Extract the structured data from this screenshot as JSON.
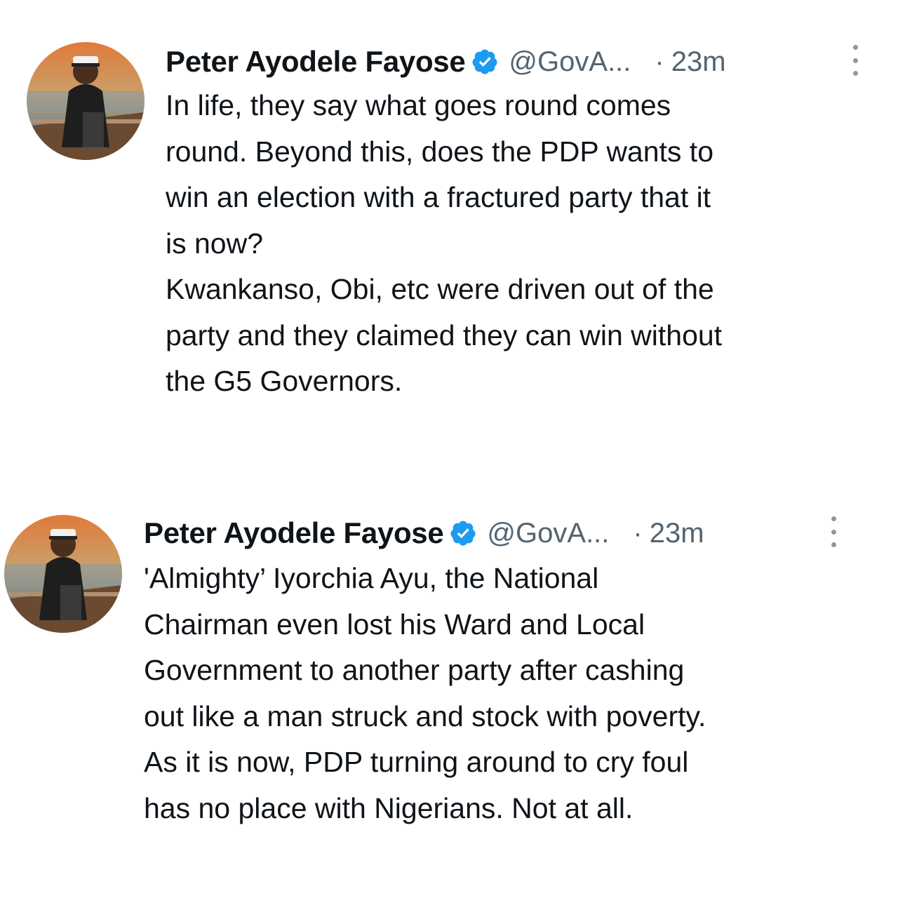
{
  "tweets": [
    {
      "author_name": "Peter Ayodele Fayose",
      "verified_icon": "verified-badge-icon",
      "handle": "@GovA...",
      "separator": "·",
      "time": "23m",
      "more_icon": "more-vertical-icon",
      "lines": [
        "In life, they say what goes round comes",
        "round. Beyond this, does the PDP wants to",
        "win an election with a fractured party that it",
        "is now?",
        "Kwankanso, Obi, etc were driven out of the",
        "party and they claimed they can win without",
        "the G5 Governors."
      ]
    },
    {
      "author_name": "Peter Ayodele Fayose",
      "verified_icon": "verified-badge-icon",
      "handle": "@GovA...",
      "separator": "·",
      "time": "23m",
      "more_icon": "more-vertical-icon",
      "lines": [
        "'Almighty’ Iyorchia Ayu, the National",
        "Chairman even lost his Ward and Local",
        "Government to another party after cashing",
        "out like a man struck and stock with poverty.",
        "As it is now, PDP turning around to cry foul",
        "has no place with Nigerians. Not at all."
      ]
    }
  ],
  "colors": {
    "text_primary": "#0f1419",
    "text_secondary": "#536471",
    "verified_blue": "#1d9bf0"
  }
}
